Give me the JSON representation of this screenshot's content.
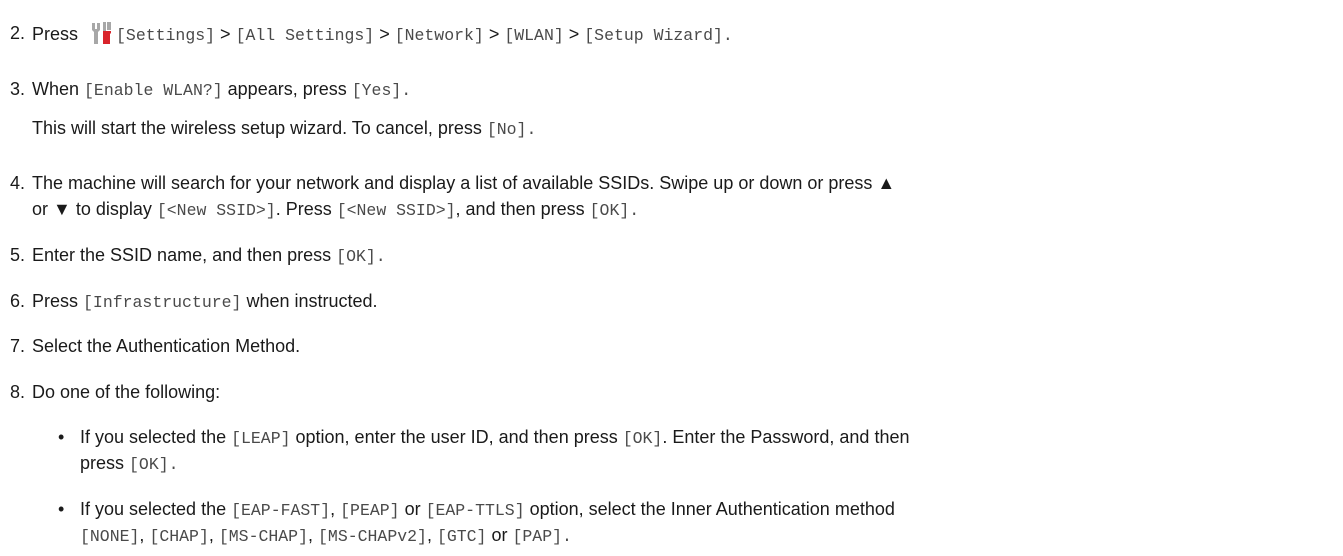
{
  "steps": [
    {
      "num": "2.",
      "parts": [
        {
          "t": "Press "
        },
        {
          "icon": "settings-icon"
        },
        {
          "m": "[Settings]"
        },
        {
          "t": " > "
        },
        {
          "m": "[All Settings]"
        },
        {
          "t": " > "
        },
        {
          "m": "[Network]"
        },
        {
          "t": " > "
        },
        {
          "m": "[WLAN]"
        },
        {
          "t": " > "
        },
        {
          "m": "[Setup Wizard]"
        },
        {
          "t": "."
        }
      ]
    },
    {
      "num": "3.",
      "parts": [
        {
          "t": "When "
        },
        {
          "m": "[Enable WLAN?]"
        },
        {
          "t": " appears, press "
        },
        {
          "m": "[Yes]"
        },
        {
          "t": "."
        }
      ],
      "note": [
        {
          "t": "This will start the wireless setup wizard. To cancel, press "
        },
        {
          "m": "[No]"
        },
        {
          "t": "."
        }
      ]
    },
    {
      "num": "4.",
      "parts": [
        {
          "t": "The machine will search for your network and display a list of available SSIDs. Swipe up or down or press ▲"
        }
      ],
      "line2": [
        {
          "t": "or ▼ to display "
        },
        {
          "m": "[<New SSID>]"
        },
        {
          "t": ". Press "
        },
        {
          "m": "[<New SSID>]"
        },
        {
          "t": ", and then press "
        },
        {
          "m": "[OK]"
        },
        {
          "t": "."
        }
      ]
    },
    {
      "num": "5.",
      "parts": [
        {
          "t": "Enter the SSID name, and then press "
        },
        {
          "m": "[OK]"
        },
        {
          "t": "."
        }
      ]
    },
    {
      "num": "6.",
      "parts": [
        {
          "t": "Press "
        },
        {
          "m": "[Infrastructure]"
        },
        {
          "t": " when instructed."
        }
      ]
    },
    {
      "num": "7.",
      "parts": [
        {
          "t": "Select the Authentication Method."
        }
      ]
    },
    {
      "num": "8.",
      "parts": [
        {
          "t": "Do one of the following:"
        }
      ]
    }
  ],
  "bullets": [
    {
      "dot": "•",
      "line1": [
        {
          "t": "If you selected the "
        },
        {
          "m": "[LEAP]"
        },
        {
          "t": " option, enter the user ID, and then press "
        },
        {
          "m": "[OK]"
        },
        {
          "t": ". Enter the Password, and then"
        }
      ],
      "line2": [
        {
          "t": "press "
        },
        {
          "m": "[OK]"
        },
        {
          "t": "."
        }
      ]
    },
    {
      "dot": "•",
      "line1": [
        {
          "t": "If you selected the "
        },
        {
          "m": "[EAP-FAST]"
        },
        {
          "t": ", "
        },
        {
          "m": "[PEAP]"
        },
        {
          "t": " or "
        },
        {
          "m": "[EAP-TTLS]"
        },
        {
          "t": " option, select the Inner Authentication method"
        }
      ],
      "line2": [
        {
          "m": "[NONE]"
        },
        {
          "t": ", "
        },
        {
          "m": "[CHAP]"
        },
        {
          "t": ", "
        },
        {
          "m": "[MS-CHAP]"
        },
        {
          "t": ", "
        },
        {
          "m": "[MS-CHAPv2]"
        },
        {
          "t": ", "
        },
        {
          "m": "[GTC]"
        },
        {
          "t": " or "
        },
        {
          "m": "[PAP]"
        },
        {
          "t": "."
        }
      ]
    }
  ],
  "colors": {
    "icon_gray": "#a7a7a7",
    "icon_red": "#d9242b",
    "mono_text": "#4a4a4a"
  }
}
